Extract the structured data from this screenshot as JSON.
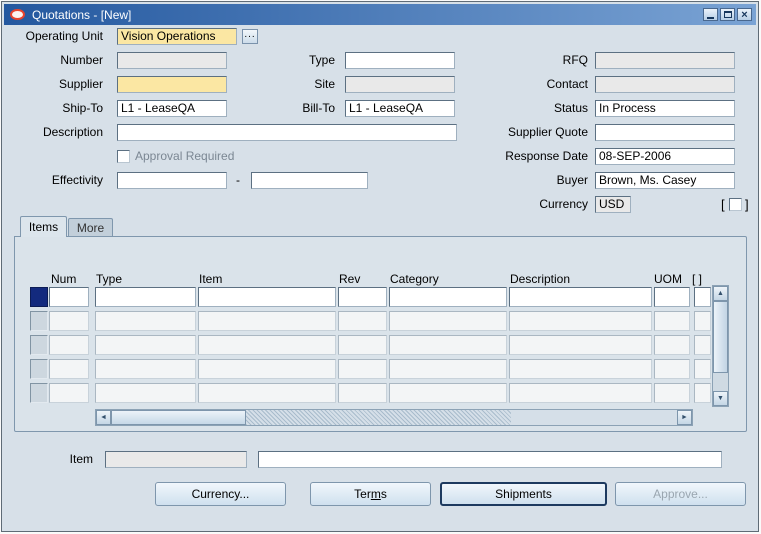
{
  "window": {
    "title": "Quotations - [New]"
  },
  "icons": {
    "close": "×",
    "scroll_up": "▲",
    "scroll_down": "▼",
    "scroll_left": "◄",
    "scroll_right": "►"
  },
  "colors": {
    "titlebar": "#24589f",
    "canvas": "#d7e0e8",
    "required_field": "#fbe7a3",
    "disabled_field": "#e9e9e9",
    "current_record": "#132a7e"
  },
  "form": {
    "operating_unit": {
      "label": "Operating Unit",
      "value": "Vision Operations",
      "lov": "..."
    },
    "number": {
      "label": "Number",
      "value": ""
    },
    "type": {
      "label": "Type",
      "value": ""
    },
    "rfq": {
      "label": "RFQ",
      "value": ""
    },
    "supplier": {
      "label": "Supplier",
      "value": ""
    },
    "site": {
      "label": "Site",
      "value": ""
    },
    "contact": {
      "label": "Contact",
      "value": ""
    },
    "ship_to": {
      "label": "Ship-To",
      "value": "L1 - LeaseQA"
    },
    "bill_to": {
      "label": "Bill-To",
      "value": "L1 - LeaseQA"
    },
    "status": {
      "label": "Status",
      "value": "In Process"
    },
    "description": {
      "label": "Description",
      "value": ""
    },
    "supplier_quote": {
      "label": "Supplier Quote",
      "value": ""
    },
    "approval_required": {
      "label": "Approval Required",
      "checked": false
    },
    "response_date": {
      "label": "Response Date",
      "value": "08-SEP-2006"
    },
    "effectivity": {
      "label": "Effectivity",
      "from": "",
      "separator": "-",
      "to": ""
    },
    "buyer": {
      "label": "Buyer",
      "value": "Brown, Ms. Casey"
    },
    "currency": {
      "label": "Currency",
      "value": "USD",
      "flex_open": "[",
      "flex_close": "]"
    }
  },
  "tabs": [
    {
      "label": "Items",
      "active": true
    },
    {
      "label": "More",
      "active": false
    }
  ],
  "grid": {
    "columns": [
      "Num",
      "Type",
      "Item",
      "Rev",
      "Category",
      "Description",
      "UOM",
      "[ ]"
    ],
    "visible_rows": 5
  },
  "footer": {
    "item": {
      "label": "Item",
      "value": "",
      "description": ""
    }
  },
  "buttons": {
    "currency": {
      "label": "Currency...",
      "enabled": true
    },
    "terms": {
      "pre": "Ter",
      "accel": "m",
      "post": "s",
      "enabled": true
    },
    "shipments": {
      "label": "Shipments",
      "enabled": true,
      "default": true
    },
    "approve": {
      "label": "Approve...",
      "enabled": false
    }
  }
}
